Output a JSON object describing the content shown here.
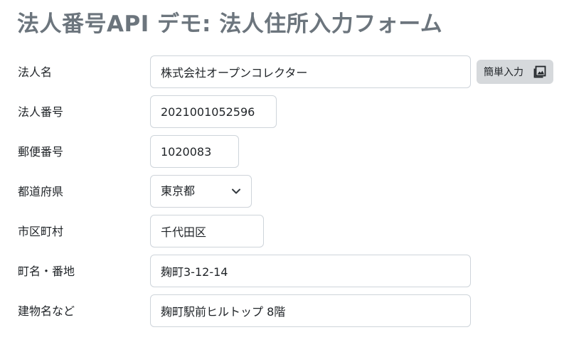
{
  "page": {
    "title": "法人番号API デモ: 法人住所入力フォーム"
  },
  "form": {
    "name": {
      "label": "法人名",
      "value": "株式会社オープンコレクター"
    },
    "easy_input": {
      "label": "簡単入力"
    },
    "number": {
      "label": "法人番号",
      "value": "2021001052596"
    },
    "postal": {
      "label": "郵便番号",
      "value": "1020083"
    },
    "prefecture": {
      "label": "都道府県",
      "value": "東京都"
    },
    "city": {
      "label": "市区町村",
      "value": "千代田区"
    },
    "street": {
      "label": "町名・番地",
      "value": "麹町3-12-14"
    },
    "building": {
      "label": "建物名など",
      "value": "麹町駅前ヒルトップ 8階"
    }
  },
  "icons": {
    "easy_input_icon": "image-gallery-icon",
    "prefecture_chevron": "chevron-down-icon"
  },
  "colors": {
    "title": "#6c757d",
    "border": "#ced4da",
    "button_bg": "#d6d9dc"
  }
}
